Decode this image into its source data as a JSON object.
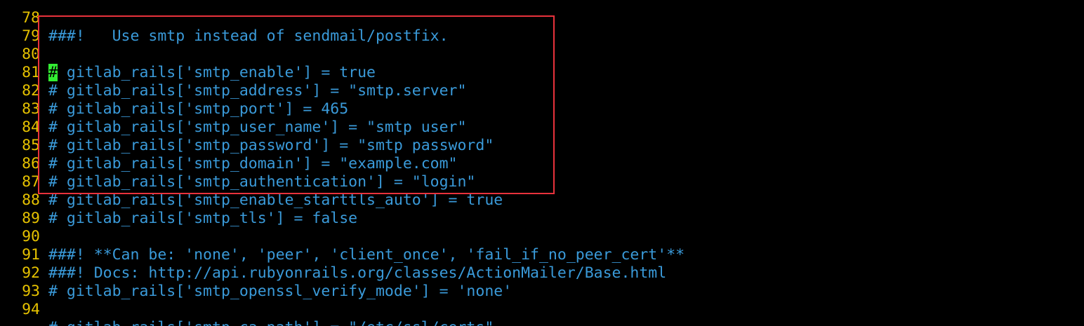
{
  "editor": {
    "lines": [
      {
        "number": "78",
        "text": "###!   Use smtp instead of sendmail/postfix."
      },
      {
        "number": "79",
        "text": ""
      },
      {
        "number": "80",
        "cursor": "#",
        "text": " gitlab_rails['smtp_enable'] = true"
      },
      {
        "number": "81",
        "text": "# gitlab_rails['smtp_address'] = \"smtp.server\""
      },
      {
        "number": "82",
        "text": "# gitlab_rails['smtp_port'] = 465"
      },
      {
        "number": "83",
        "text": "# gitlab_rails['smtp_user_name'] = \"smtp user\""
      },
      {
        "number": "84",
        "text": "# gitlab_rails['smtp_password'] = \"smtp password\""
      },
      {
        "number": "85",
        "text": "# gitlab_rails['smtp_domain'] = \"example.com\""
      },
      {
        "number": "86",
        "text": "# gitlab_rails['smtp_authentication'] = \"login\""
      },
      {
        "number": "87",
        "text": "# gitlab_rails['smtp_enable_starttls_auto'] = true"
      },
      {
        "number": "88",
        "text": "# gitlab_rails['smtp_tls'] = false"
      },
      {
        "number": "89",
        "text": ""
      },
      {
        "number": "90",
        "text": "###! **Can be: 'none', 'peer', 'client_once', 'fail_if_no_peer_cert'**"
      },
      {
        "number": "91",
        "text": "###! Docs: http://api.rubyonrails.org/classes/ActionMailer/Base.html"
      },
      {
        "number": "92",
        "text": "# gitlab_rails['smtp_openssl_verify_mode'] = 'none'"
      },
      {
        "number": "93",
        "text": ""
      },
      {
        "number": "94",
        "text": "# gitlab_rails['smtp_ca_path'] = \"/etc/ssl/certs\""
      }
    ]
  },
  "colors": {
    "background": "#000000",
    "line_number": "#e6c200",
    "code_text": "#3a9ad9",
    "cursor": "#33ee33",
    "highlight_box": "#e8323c"
  }
}
